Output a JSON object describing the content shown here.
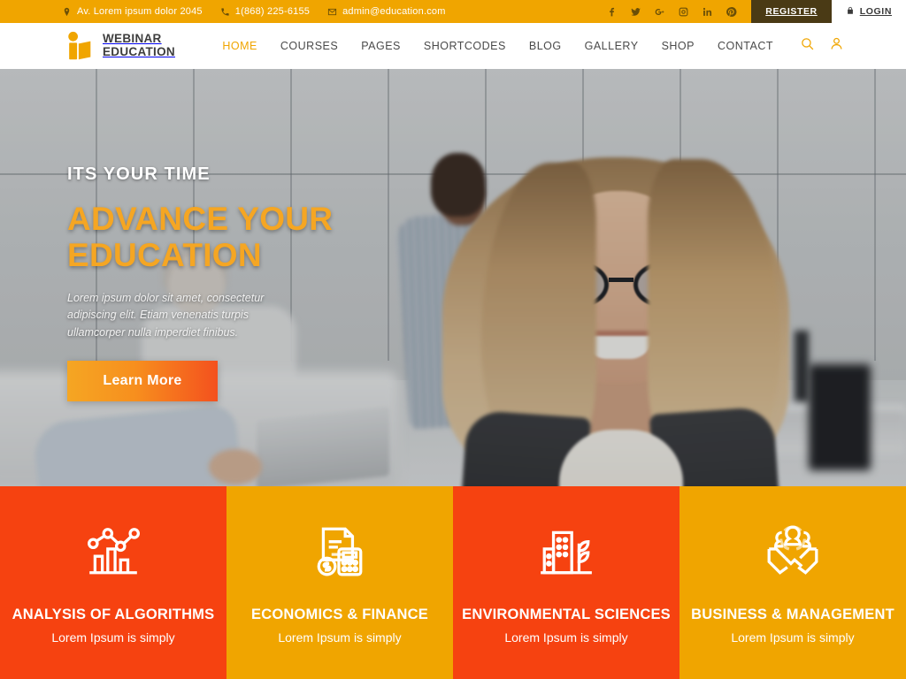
{
  "topbar": {
    "address": "Av. Lorem ipsum dolor 2045",
    "phone": "1(868) 225-6155",
    "email": "admin@education.com",
    "socials": [
      {
        "name": "facebook-icon",
        "label": "Facebook"
      },
      {
        "name": "twitter-icon",
        "label": "Twitter"
      },
      {
        "name": "google-plus-icon",
        "label": "Google Plus"
      },
      {
        "name": "instagram-icon",
        "label": "Instagram"
      },
      {
        "name": "linkedin-icon",
        "label": "LinkedIn"
      },
      {
        "name": "pinterest-icon",
        "label": "Pinterest"
      }
    ],
    "register_label": "REGISTER",
    "login_label": "LOGIN",
    "bg_color": "#F0A500",
    "register_bg": "#4A3A15",
    "login_bg": "#FFFFFF"
  },
  "header": {
    "logo_line1": "WEBINAR",
    "logo_line2": "EDUCATION",
    "logo_color": "#F0A500",
    "nav": [
      {
        "label": "HOME",
        "active": true
      },
      {
        "label": "COURSES",
        "active": false
      },
      {
        "label": "PAGES",
        "active": false
      },
      {
        "label": "SHORTCODES",
        "active": false
      },
      {
        "label": "BLOG",
        "active": false
      },
      {
        "label": "GALLERY",
        "active": false
      },
      {
        "label": "SHOP",
        "active": false
      },
      {
        "label": "CONTACT",
        "active": false
      }
    ],
    "search_icon": "search-icon",
    "account_icon": "user-icon"
  },
  "hero": {
    "eyebrow": "ITS YOUR TIME",
    "title_line1": "ADVANCE YOUR",
    "title_line2": "EDUCATION",
    "title_color": "#F5A623",
    "subtitle": "Lorem ipsum dolor sit amet, consectetur adipiscing elit. Etiam venenatis turpis ullamcorper nulla imperdiet finibus.",
    "button_label": "Learn More"
  },
  "features": [
    {
      "title": "ANALYSIS OF ALGORITHMS",
      "desc": "Lorem Ipsum is simply",
      "icon": "analytics-chart-icon",
      "bg": "#F64210"
    },
    {
      "title": "ECONOMICS & FINANCE",
      "desc": "Lorem Ipsum is simply",
      "icon": "invoice-calculator-icon",
      "bg": "#F0A500"
    },
    {
      "title": "ENVIRONMENTAL SCIENCES",
      "desc": "Lorem Ipsum is simply",
      "icon": "buildings-plant-icon",
      "bg": "#F64210"
    },
    {
      "title": "BUSINESS & MANAGEMENT",
      "desc": "Lorem Ipsum is simply",
      "icon": "handshake-team-icon",
      "bg": "#F0A500"
    }
  ]
}
